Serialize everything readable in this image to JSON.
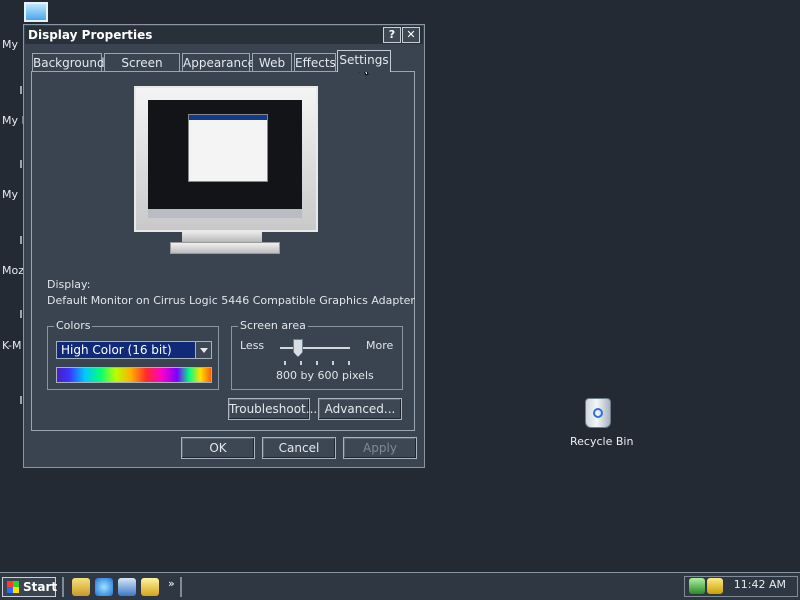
{
  "desktop": {
    "left_labels": [
      "My",
      "My D",
      "My",
      "Moz",
      "K-M"
    ],
    "recycle_bin": "Recycle Bin"
  },
  "dialog": {
    "title": "Display Properties",
    "help_button": "?",
    "close_button": "✕",
    "tabs": [
      "Background",
      "Screen Saver",
      "Appearance",
      "Web",
      "Effects",
      "Settings"
    ],
    "active_tab": "Settings",
    "display_label": "Display:",
    "display_value": "Default Monitor on Cirrus Logic 5446 Compatible Graphics Adapter",
    "colors": {
      "legend": "Colors",
      "selected": "High Color (16 bit)"
    },
    "screen_area": {
      "legend": "Screen area",
      "less": "Less",
      "more": "More",
      "value": "800 by 600 pixels",
      "slider_level": 0.25
    },
    "buttons": {
      "troubleshoot": "Troubleshoot...",
      "advanced": "Advanced...",
      "ok": "OK",
      "cancel": "Cancel",
      "apply": "Apply"
    }
  },
  "taskbar": {
    "start": "Start",
    "overflow": "»",
    "clock": "11:42 AM"
  },
  "colors": {
    "desktop_bg": "#232a33",
    "dialog_bg": "#3a4450",
    "select_highlight": "#102a78"
  }
}
